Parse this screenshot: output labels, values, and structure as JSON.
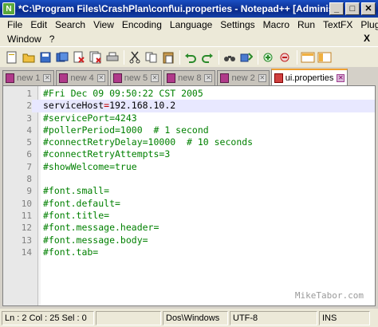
{
  "window": {
    "title": "*C:\\Program Files\\CrashPlan\\conf\\ui.properties - Notepad++ [Adminis...",
    "app_icon": "notepadpp-icon",
    "minimize_label": "_",
    "maximize_label": "□",
    "close_label": "✕"
  },
  "menu": {
    "row1": [
      "File",
      "Edit",
      "Search",
      "View",
      "Encoding",
      "Language",
      "Settings",
      "Macro",
      "Run",
      "TextFX",
      "Plugins"
    ],
    "row2": [
      "Window",
      "?"
    ],
    "doc_close": "X"
  },
  "toolbar": {
    "icons": [
      "new-file-icon",
      "open-file-icon",
      "save-icon",
      "save-all-icon",
      "close-icon",
      "close-all-icon",
      "print-icon",
      "cut-icon",
      "copy-icon",
      "paste-icon",
      "undo-icon",
      "redo-icon",
      "find-icon",
      "replace-icon",
      "zoom-in-icon",
      "zoom-out-icon",
      "sync-v-icon",
      "sync-h-icon"
    ]
  },
  "tabs": [
    {
      "label": "new 1",
      "active": false
    },
    {
      "label": "new 4",
      "active": false
    },
    {
      "label": "new 5",
      "active": false
    },
    {
      "label": "new 8",
      "active": false
    },
    {
      "label": "new 2",
      "active": false
    },
    {
      "label": "ui.properties",
      "active": true
    }
  ],
  "editor": {
    "current_line": 2,
    "lines": [
      {
        "n": "1",
        "text": "#Fri Dec 09 09:50:22 CST 2005",
        "kind": "comment"
      },
      {
        "n": "2",
        "key": "serviceHost",
        "eq": "=",
        "val": "192.168.10.2",
        "kind": "prop"
      },
      {
        "n": "3",
        "text": "#servicePort=4243",
        "kind": "comment"
      },
      {
        "n": "4",
        "text": "#pollerPeriod=1000  # 1 second",
        "kind": "comment"
      },
      {
        "n": "5",
        "text": "#connectRetryDelay=10000  # 10 seconds",
        "kind": "comment"
      },
      {
        "n": "6",
        "text": "#connectRetryAttempts=3",
        "kind": "comment"
      },
      {
        "n": "7",
        "text": "#showWelcome=true",
        "kind": "comment"
      },
      {
        "n": "8",
        "text": "",
        "kind": "comment"
      },
      {
        "n": "9",
        "text": "#font.small=",
        "kind": "comment"
      },
      {
        "n": "10",
        "text": "#font.default=",
        "kind": "comment"
      },
      {
        "n": "11",
        "text": "#font.title=",
        "kind": "comment"
      },
      {
        "n": "12",
        "text": "#font.message.header=",
        "kind": "comment"
      },
      {
        "n": "13",
        "text": "#font.message.body=",
        "kind": "comment"
      },
      {
        "n": "14",
        "text": "#font.tab=",
        "kind": "comment"
      }
    ],
    "watermark": "MikeTabor.com"
  },
  "status": {
    "position": "Ln : 2   Col : 25   Sel : 0",
    "line_ending": "Dos\\Windows",
    "encoding": "UTF-8",
    "mode": "INS"
  },
  "colors": {
    "comment": "#008000",
    "operator": "#c00000",
    "current_line": "#e8e8ff",
    "title_bar": "#0a2a8a"
  }
}
